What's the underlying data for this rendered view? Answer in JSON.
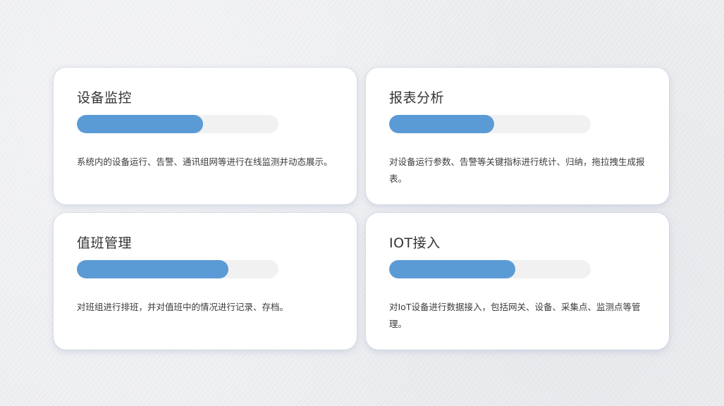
{
  "cards": [
    {
      "title": "设备监控",
      "progress": 0.625,
      "description": "系统内的设备运行、告警、通讯组网等进行在线监测并动态展示。"
    },
    {
      "title": "报表分析",
      "progress": 0.52,
      "description": "对设备运行参数、告警等关键指标进行统计、归纳，拖拉拽生成报表。"
    },
    {
      "title": "值班管理",
      "progress": 0.75,
      "description": "对班组进行排班，并对值班中的情况进行记录、存档。"
    },
    {
      "title": "IOT接入",
      "progress": 0.625,
      "description": "对IoT设备进行数据接入，包括网关、设备、采集点、监测点等管理。"
    }
  ],
  "colors": {
    "progress_fill": "#5b9bd5",
    "progress_track": "#f1f1f2",
    "card_background": "#ffffff"
  }
}
